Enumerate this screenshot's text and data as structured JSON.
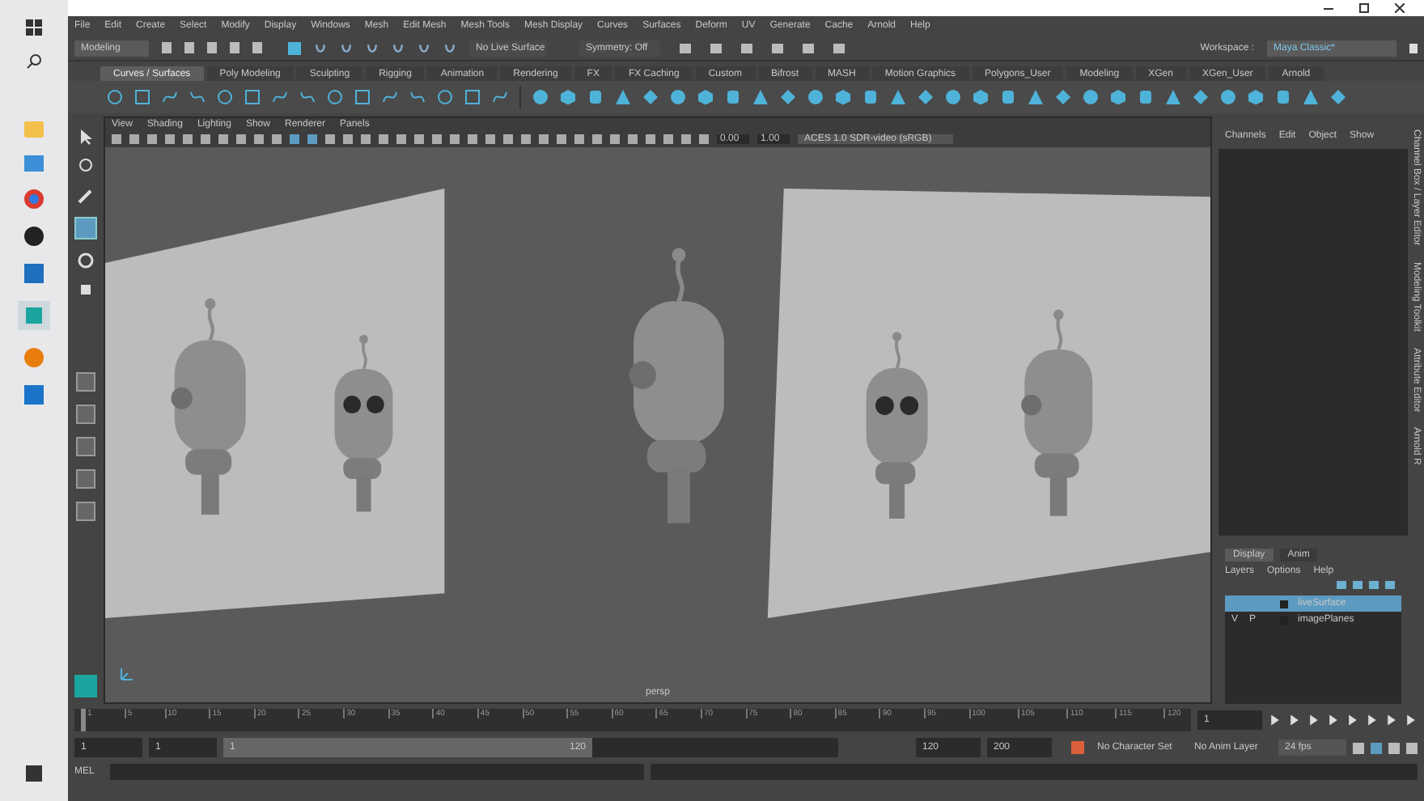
{
  "menu_bar": [
    "File",
    "Edit",
    "Create",
    "Select",
    "Modify",
    "Display",
    "Windows",
    "Mesh",
    "Edit Mesh",
    "Mesh Tools",
    "Mesh Display",
    "Curves",
    "Surfaces",
    "Deform",
    "UV",
    "Generate",
    "Cache",
    "Arnold",
    "Help"
  ],
  "status_line": {
    "menu_set": "Modeling",
    "live_surface": "No Live Surface",
    "symmetry": "Symmetry: Off",
    "workspace_label": "Workspace :",
    "workspace": "Maya Classic*"
  },
  "shelf_tabs": [
    {
      "label": "Curves / Surfaces",
      "selected": true
    },
    {
      "label": "Poly Modeling",
      "selected": false
    },
    {
      "label": "Sculpting",
      "selected": false
    },
    {
      "label": "Rigging",
      "selected": false
    },
    {
      "label": "Animation",
      "selected": false
    },
    {
      "label": "Rendering",
      "selected": false
    },
    {
      "label": "FX",
      "selected": false
    },
    {
      "label": "FX Caching",
      "selected": false
    },
    {
      "label": "Custom",
      "selected": false
    },
    {
      "label": "Bifrost",
      "selected": false
    },
    {
      "label": "MASH",
      "selected": false
    },
    {
      "label": "Motion Graphics",
      "selected": false
    },
    {
      "label": "Polygons_User",
      "selected": false
    },
    {
      "label": "Modeling",
      "selected": false
    },
    {
      "label": "XGen",
      "selected": false
    },
    {
      "label": "XGen_User",
      "selected": false
    },
    {
      "label": "Arnold",
      "selected": false
    }
  ],
  "viewport": {
    "menus": [
      "View",
      "Shading",
      "Lighting",
      "Show",
      "Renderer",
      "Panels"
    ],
    "exposure": "0.00",
    "gamma": "1.00",
    "color_space": "ACES 1.0 SDR-video (sRGB)",
    "camera": "persp"
  },
  "channel_box": {
    "menus": [
      "Channels",
      "Edit",
      "Object",
      "Show"
    ]
  },
  "side_tabs": [
    "Channel Box / Layer Editor",
    "Modeling Toolkit",
    "Attribute Editor",
    "Arnold R"
  ],
  "layer_editor": {
    "tabs": [
      {
        "label": "Display",
        "selected": true
      },
      {
        "label": "Anim",
        "selected": false
      }
    ],
    "menus": [
      "Layers",
      "Options",
      "Help"
    ],
    "layers": [
      {
        "name": "liveSurface",
        "selected": true
      },
      {
        "visible": "V",
        "playback": "P",
        "name": "imagePlanes",
        "selected": false
      }
    ]
  },
  "timeline": {
    "ticks": [
      "1",
      "5",
      "10",
      "15",
      "20",
      "25",
      "30",
      "35",
      "40",
      "45",
      "50",
      "55",
      "60",
      "65",
      "70",
      "75",
      "80",
      "85",
      "90",
      "95",
      "100",
      "105",
      "110",
      "115",
      "120"
    ],
    "current_frame": "1",
    "level": 0
  },
  "range": {
    "start": "1",
    "inner_start": "1",
    "slider_start": "1",
    "slider_end": "120",
    "level": 0.6,
    "inner_end": "120",
    "end": "200",
    "character_set": "No Character Set",
    "anim_layer": "No Anim Layer",
    "fps": "24 fps"
  },
  "command_line": {
    "label": "MEL"
  }
}
